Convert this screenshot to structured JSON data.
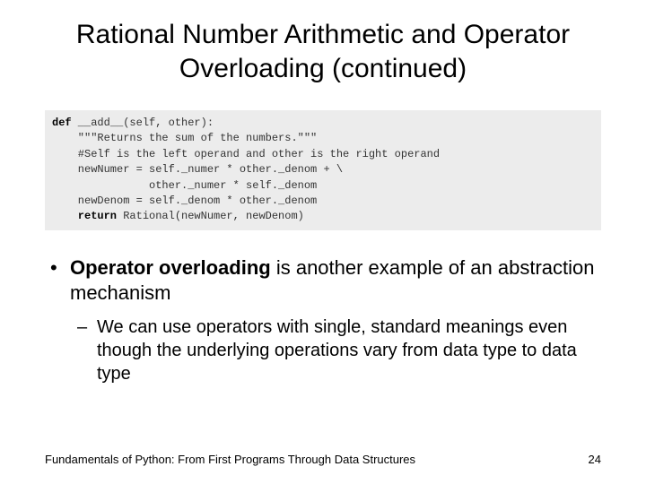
{
  "title": "Rational Number Arithmetic and Operator Overloading (continued)",
  "code": {
    "kw_def": "def",
    "sig": " __add__(self, other):",
    "l2": "    \"\"\"Returns the sum of the numbers.\"\"\"",
    "l3": "    #Self is the left operand and other is the right operand",
    "l4": "    newNumer = self._numer * other._denom + \\",
    "l5": "               other._numer * self._denom",
    "l6": "    newDenom = self._denom * other._denom",
    "kw_return": "    return",
    "l7rest": " Rational(newNumer, newDenom)"
  },
  "bullet1_bold": "Operator overloading",
  "bullet1_rest": " is another example of an abstraction mechanism",
  "bullet2": "We can use operators with single, standard meanings even though the underlying operations vary from data type to data type",
  "footer_left": "Fundamentals of Python: From First Programs Through Data Structures",
  "footer_right": "24"
}
